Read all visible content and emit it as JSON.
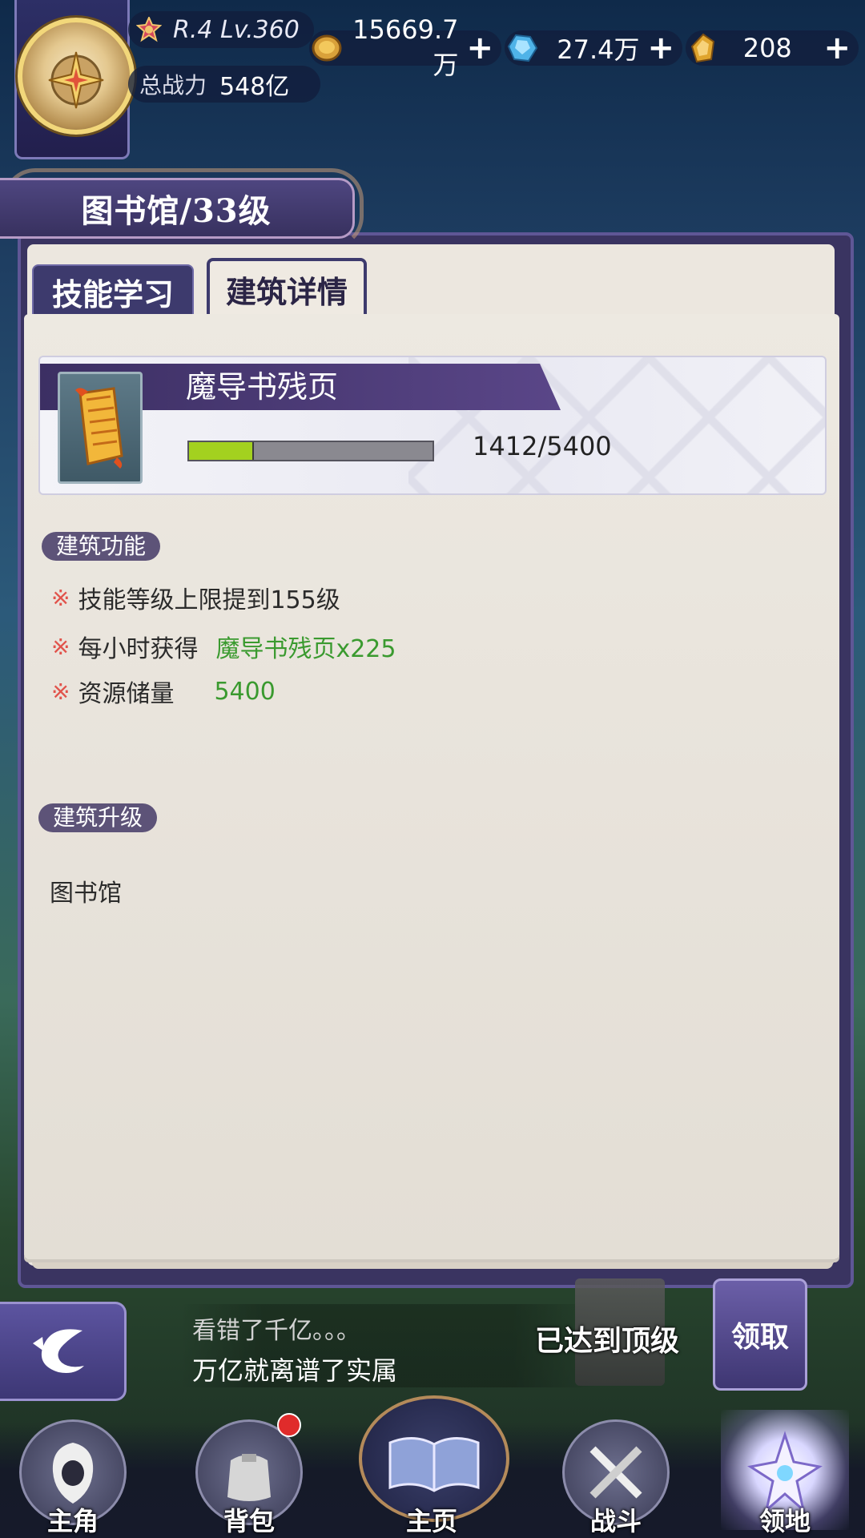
{
  "player": {
    "level_text": "R.4 Lv.360",
    "power_label": "总战力",
    "power_value": "548亿"
  },
  "resources": [
    {
      "icon": "gold-coin-icon",
      "value": "15669.7万"
    },
    {
      "icon": "blue-crystal-icon",
      "value": "27.4万"
    },
    {
      "icon": "gold-gem-icon",
      "value": "208"
    }
  ],
  "panel": {
    "title": "图书馆/33级",
    "tabs": [
      {
        "label": "技能学习",
        "active": false
      },
      {
        "label": "建筑详情",
        "active": true
      }
    ]
  },
  "item": {
    "name": "魔导书残页",
    "icon": "scroll-icon",
    "current": 1412,
    "max": 5400,
    "progress_text": "1412/5400",
    "progress_fraction": 0.26
  },
  "function_section": {
    "title": "建筑功能",
    "rows": [
      {
        "mark": "※",
        "label": "技能等级上限提到155级",
        "value": ""
      },
      {
        "mark": "※",
        "label": "每小时获得",
        "value": "魔导书残页x225"
      },
      {
        "mark": "※",
        "label": "资源储量",
        "value": "5400"
      }
    ]
  },
  "upgrade_section": {
    "title": "建筑升级",
    "text": "图书馆"
  },
  "chat": {
    "line1": "看错了千亿。。。",
    "line2": "万亿就离谱了实属"
  },
  "max_level_text": "已达到顶级",
  "claim_label": "领取",
  "bottom_nav": [
    {
      "label": "主角",
      "icon": "hero-icon"
    },
    {
      "label": "背包",
      "icon": "bag-icon",
      "badge": true
    },
    {
      "label": "主页",
      "icon": "book-icon"
    },
    {
      "label": "战斗",
      "icon": "crossed-swords-icon"
    },
    {
      "label": "领地",
      "icon": "crystal-castle-icon"
    }
  ],
  "colors": {
    "accent_purple": "#3d3a6d",
    "progress_green": "#a3d11f",
    "value_green": "#3a9a2f",
    "mark_red": "#e1534b"
  }
}
